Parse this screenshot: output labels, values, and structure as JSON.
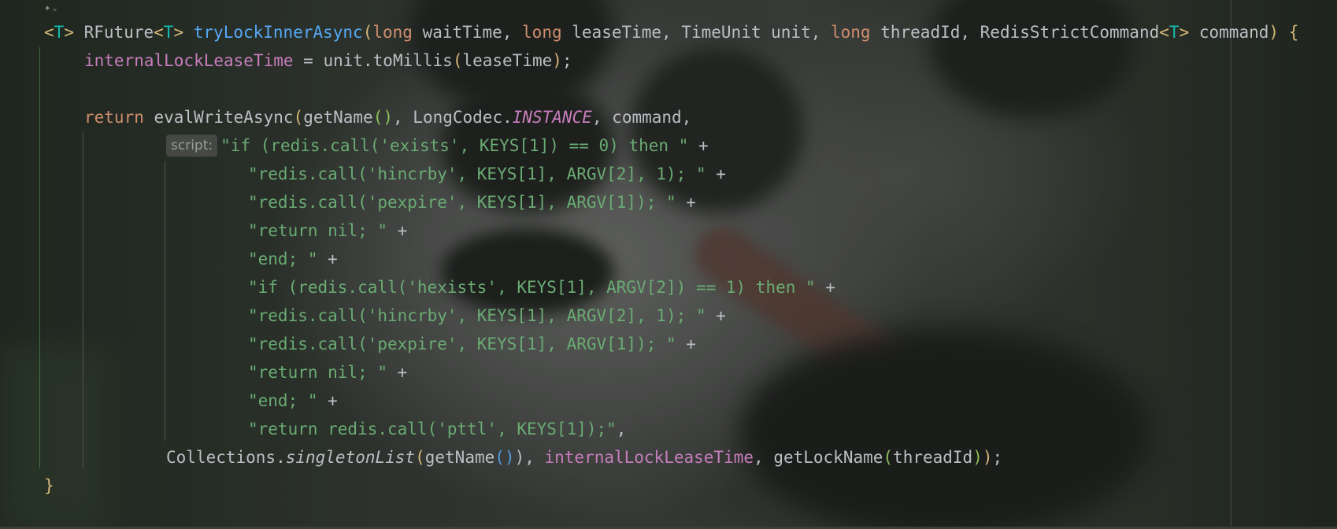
{
  "editor": {
    "inlay_hint": "script:",
    "signature": {
      "generic_open": "<",
      "generic_type": "T",
      "generic_close": ">",
      "return_type": "RFuture",
      "method_name": "tryLockInnerAsync",
      "param1_type": "long",
      "param1_name": "waitTime, ",
      "param2_type": "long",
      "param2_name": "leaseTime, TimeUnit unit, ",
      "param3_type": "long",
      "param3_name": "threadId, RedisStrictCommand",
      "param4_name": "command",
      "open_brace": "{"
    },
    "assign": {
      "field": "internalLockLeaseTime",
      "rest": " = unit.toMillis",
      "arg": "leaseTime"
    },
    "return_line": {
      "keyword": "return",
      "call": "evalWriteAsync",
      "inner": "getName",
      "codec_class": "LongCodec.",
      "codec_const": "INSTANCE",
      "tail": ", command,"
    },
    "script_lines": [
      "\"if (redis.call('exists', KEYS[1]) == 0) then \"",
      "\"redis.call('hincrby', KEYS[1], ARGV[2], 1); \"",
      "\"redis.call('pexpire', KEYS[1], ARGV[1]); \"",
      "\"return nil; \"",
      "\"end; \"",
      "\"if (redis.call('hexists', KEYS[1], ARGV[2]) == 1) then \"",
      "\"redis.call('hincrby', KEYS[1], ARGV[2], 1); \"",
      "\"redis.call('pexpire', KEYS[1], ARGV[1]); \"",
      "\"return nil; \"",
      "\"end; \"",
      "\"return redis.call('pttl', KEYS[1]);\""
    ],
    "plus": " +",
    "last_comma": ",",
    "collections_line": {
      "cls": "Collections.",
      "method": "singletonList",
      "inner": "getName",
      "field": "internalLockLeaseTime",
      "lock_call": "getLockName",
      "arg": "threadId",
      "end": ";"
    },
    "close_brace": "}"
  },
  "colors": {
    "keyword": "#cf8e6d",
    "function": "#56a8f5",
    "string": "#6aab73",
    "field": "#c77dbb",
    "generic": "#16baac",
    "default": "#bcbec4"
  }
}
